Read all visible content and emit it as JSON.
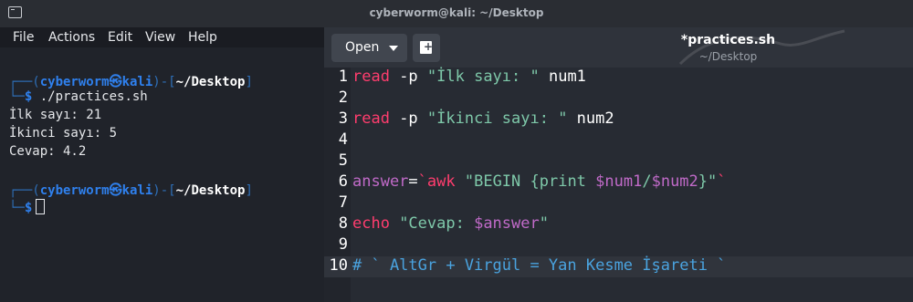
{
  "terminal": {
    "title": "cyberworm@kali: ~/Desktop",
    "menu": [
      "File",
      "Actions",
      "Edit",
      "View",
      "Help"
    ],
    "prompt_user": "cyberworm",
    "prompt_symbol": "㉿",
    "prompt_host": "kali",
    "prompt_dir": "~/Desktop",
    "command": "./practices.sh",
    "output": [
      "İlk sayı: 21",
      "İkinci sayı: 5",
      "Cevap: 4.2"
    ]
  },
  "editor": {
    "open_label": "Open",
    "file_title": "*practices.sh",
    "file_subtitle": "~/Desktop",
    "lines": [
      {
        "num": "1",
        "read": "read",
        "flag": " -p ",
        "str": "\"İlk sayı: \"",
        "rest": " num1"
      },
      {
        "num": "2"
      },
      {
        "num": "3",
        "read": "read",
        "flag": " -p ",
        "str": "\"İkinci sayı: \"",
        "rest": " num2"
      },
      {
        "num": "4"
      },
      {
        "num": "5"
      },
      {
        "num": "6",
        "a": "answer",
        "b": "=",
        "c": "`awk",
        "d": " \"BEGIN {print ",
        "e": "$num1",
        "f": "/",
        "g": "$num2",
        "h": "}\"",
        "i": "`"
      },
      {
        "num": "7"
      },
      {
        "num": "8",
        "echo": "echo",
        "str": " \"Cevap: ",
        "var": "$answer",
        "end": "\""
      },
      {
        "num": "9"
      },
      {
        "num": "10",
        "comment": "# ` AltGr + Virgül = Yan Kesme İşareti `"
      }
    ]
  }
}
